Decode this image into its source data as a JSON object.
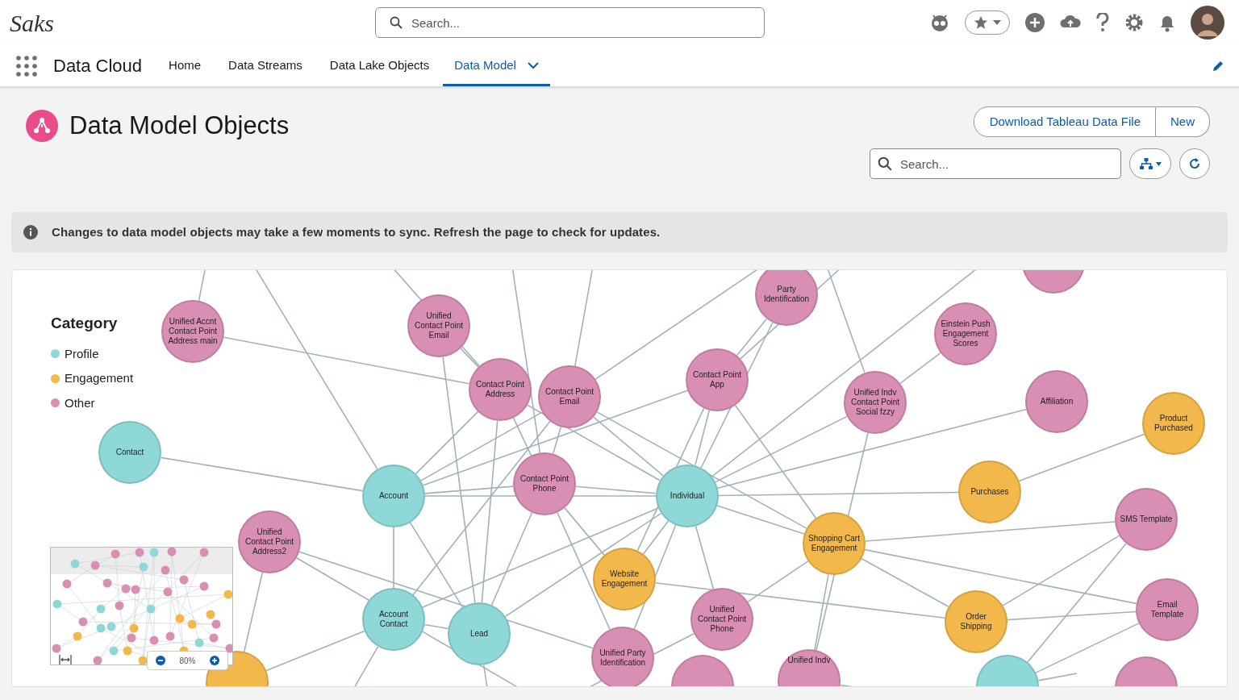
{
  "header": {
    "logo": "Saks",
    "search": {
      "placeholder": "Search..."
    }
  },
  "nav": {
    "app_name": "Data Cloud",
    "tabs": [
      {
        "label": "Home",
        "selected": false
      },
      {
        "label": "Data Streams",
        "selected": false
      },
      {
        "label": "Data Lake Objects",
        "selected": false
      },
      {
        "label": "Data Model",
        "selected": true
      }
    ]
  },
  "page": {
    "title": "Data Model Objects",
    "buttons": [
      "Download Tableau Data File",
      "New"
    ],
    "search": {
      "placeholder": "Search..."
    }
  },
  "banner": {
    "text": "Changes to data model objects may take a few moments to sync. Refresh the page to check for updates."
  },
  "legend": {
    "title": "Category",
    "items": [
      {
        "label": "Profile",
        "color": "#8fd8d8"
      },
      {
        "label": "Engagement",
        "color": "#f2b84b"
      },
      {
        "label": "Other",
        "color": "#d98fb3"
      }
    ]
  },
  "nodes": [
    {
      "label": "Unified Accnt Contact Point Address main",
      "color": "#d98fb3"
    },
    {
      "label": "Unified Contact Point Email",
      "color": "#d98fb3"
    },
    {
      "label": "Party Identification",
      "color": "#d98fb3"
    },
    {
      "label": "Einstein Push Engagement Scores",
      "color": "#d98fb3"
    },
    {
      "label": "Contact Point Address",
      "color": "#d98fb3"
    },
    {
      "label": "Contact Point Email",
      "color": "#d98fb3"
    },
    {
      "label": "Contact Point App",
      "color": "#d98fb3"
    },
    {
      "label": "Unified Indv Contact Point Social fzzy",
      "color": "#d98fb3"
    },
    {
      "label": "Affiliation",
      "color": "#d98fb3"
    },
    {
      "label": "Product Purchased",
      "color": "#f2b84b"
    },
    {
      "label": "Contact",
      "color": "#8fd8d8"
    },
    {
      "label": "Account",
      "color": "#8fd8d8"
    },
    {
      "label": "Contact Point Phone",
      "color": "#d98fb3"
    },
    {
      "label": "Individual",
      "color": "#8fd8d8"
    },
    {
      "label": "Purchases",
      "color": "#f2b84b"
    },
    {
      "label": "SMS Template",
      "color": "#d98fb3"
    },
    {
      "label": "Unified Contact Point Address2",
      "color": "#d98fb3"
    },
    {
      "label": "Shopping Cart Engagement",
      "color": "#f2b84b"
    },
    {
      "label": "Website Engagement",
      "color": "#f2b84b"
    },
    {
      "label": "Account Contact",
      "color": "#8fd8d8"
    },
    {
      "label": "Lead",
      "color": "#8fd8d8"
    },
    {
      "label": "Unified Contact Point Phone",
      "color": "#d98fb3"
    },
    {
      "label": "Order Shipping",
      "color": "#f2b84b"
    },
    {
      "label": "Email Template",
      "color": "#d98fb3"
    },
    {
      "label": "Unified Party Identification",
      "color": "#d98fb3"
    },
    {
      "label": "Unified Indv",
      "color": "#d98fb3"
    },
    {
      "color": "#f2b84b"
    },
    {
      "color": "#d98fb3"
    },
    {
      "color": "#8fd8d8"
    },
    {
      "color": "#d98fb3"
    },
    {
      "color": "#d98fb3"
    }
  ],
  "minimap": {
    "zoom": "80%"
  }
}
